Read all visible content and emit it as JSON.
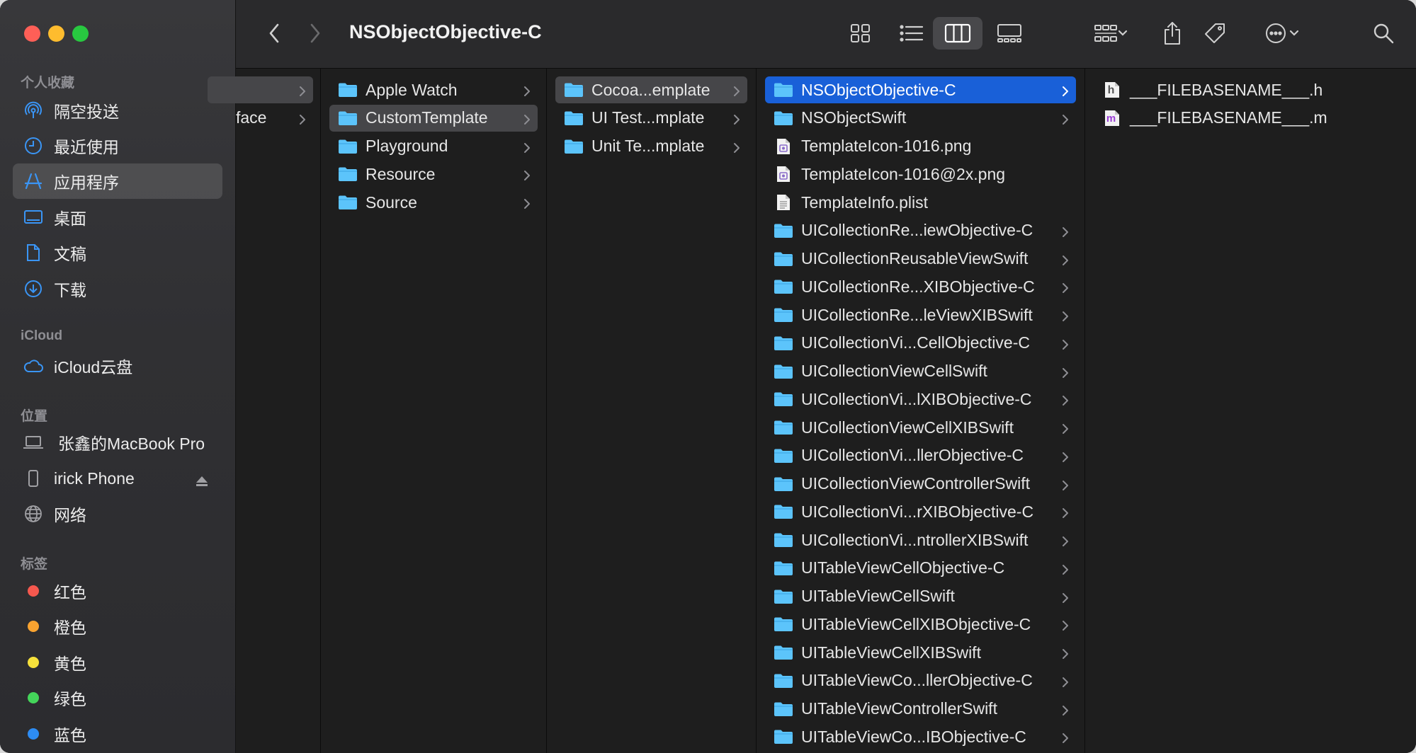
{
  "window": {
    "title": "NSObjectObjective-C"
  },
  "sidebar": {
    "favorites_header": "个人收藏",
    "favorites": [
      {
        "label": "隔空投送",
        "icon": "airdrop-icon"
      },
      {
        "label": "最近使用",
        "icon": "clock-icon"
      },
      {
        "label": "应用程序",
        "icon": "applications-icon",
        "selected": true
      },
      {
        "label": "桌面",
        "icon": "desktop-icon"
      },
      {
        "label": "文稿",
        "icon": "document-icon"
      },
      {
        "label": "下载",
        "icon": "download-icon"
      }
    ],
    "icloud_header": "iCloud",
    "icloud": [
      {
        "label": "iCloud云盘",
        "icon": "cloud-icon"
      }
    ],
    "locations_header": "位置",
    "locations": [
      {
        "label": "张鑫的MacBook Pro",
        "icon": "laptop-icon"
      },
      {
        "label": "irick Phone",
        "icon": "phone-icon",
        "eject": true
      },
      {
        "label": "网络",
        "icon": "globe-icon"
      }
    ],
    "tags_header": "标签",
    "tags": [
      {
        "label": "红色",
        "color": "#f5584e"
      },
      {
        "label": "橙色",
        "color": "#f9a330"
      },
      {
        "label": "黄色",
        "color": "#f6e13b"
      },
      {
        "label": "绿色",
        "color": "#44d55a"
      },
      {
        "label": "蓝色",
        "color": "#2d8cf3"
      }
    ]
  },
  "colors": {
    "accent": "#1960d8",
    "folder": "#5cc4fb"
  },
  "columns": [
    {
      "items": [
        {
          "name": "",
          "type": "folder",
          "selected": "gray"
        },
        {
          "name": "face",
          "type": "folder"
        }
      ]
    },
    {
      "items": [
        {
          "name": "Apple Watch",
          "type": "folder"
        },
        {
          "name": "CustomTemplate",
          "type": "folder",
          "selected": "gray"
        },
        {
          "name": "Playground",
          "type": "folder"
        },
        {
          "name": "Resource",
          "type": "folder"
        },
        {
          "name": "Source",
          "type": "folder"
        }
      ]
    },
    {
      "items": [
        {
          "name": "Cocoa...emplate",
          "type": "folder",
          "selected": "gray"
        },
        {
          "name": "UI Test...mplate",
          "type": "folder"
        },
        {
          "name": "Unit Te...mplate",
          "type": "folder"
        }
      ]
    },
    {
      "items": [
        {
          "name": "NSObjectObjective-C",
          "type": "folder",
          "selected": "blue"
        },
        {
          "name": "NSObjectSwift",
          "type": "folder"
        },
        {
          "name": "TemplateIcon-1016.png",
          "type": "image"
        },
        {
          "name": "TemplateIcon-1016@2x.png",
          "type": "image"
        },
        {
          "name": "TemplateInfo.plist",
          "type": "plist"
        },
        {
          "name": "UICollectionRe...iewObjective-C",
          "type": "folder"
        },
        {
          "name": "UICollectionReusableViewSwift",
          "type": "folder"
        },
        {
          "name": "UICollectionRe...XIBObjective-C",
          "type": "folder"
        },
        {
          "name": "UICollectionRe...leViewXIBSwift",
          "type": "folder"
        },
        {
          "name": "UICollectionVi...CellObjective-C",
          "type": "folder"
        },
        {
          "name": "UICollectionViewCellSwift",
          "type": "folder"
        },
        {
          "name": "UICollectionVi...lXIBObjective-C",
          "type": "folder"
        },
        {
          "name": "UICollectionViewCellXIBSwift",
          "type": "folder"
        },
        {
          "name": "UICollectionVi...llerObjective-C",
          "type": "folder"
        },
        {
          "name": "UICollectionViewControllerSwift",
          "type": "folder"
        },
        {
          "name": "UICollectionVi...rXIBObjective-C",
          "type": "folder"
        },
        {
          "name": "UICollectionVi...ntrollerXIBSwift",
          "type": "folder"
        },
        {
          "name": "UITableViewCellObjective-C",
          "type": "folder"
        },
        {
          "name": "UITableViewCellSwift",
          "type": "folder"
        },
        {
          "name": "UITableViewCellXIBObjective-C",
          "type": "folder"
        },
        {
          "name": "UITableViewCellXIBSwift",
          "type": "folder"
        },
        {
          "name": "UITableViewCo...llerObjective-C",
          "type": "folder"
        },
        {
          "name": "UITableViewControllerSwift",
          "type": "folder"
        },
        {
          "name": "UITableViewCo...IBObjective-C",
          "type": "folder"
        }
      ]
    },
    {
      "items": [
        {
          "name": "___FILEBASENAME___.h",
          "type": "h-file",
          "badge": "h"
        },
        {
          "name": "___FILEBASENAME___.m",
          "type": "m-file",
          "badge": "m"
        }
      ]
    }
  ]
}
